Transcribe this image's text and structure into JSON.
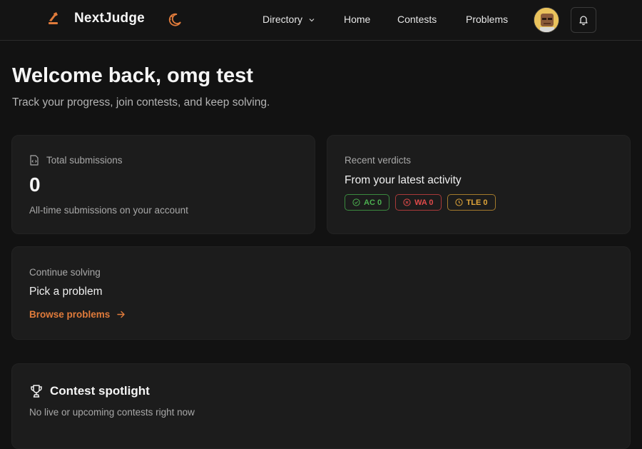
{
  "nav": {
    "brand_name": "NextJudge",
    "links": [
      {
        "label": "Directory"
      },
      {
        "label": "Home"
      },
      {
        "label": "Contests"
      },
      {
        "label": "Problems"
      }
    ],
    "icons": {
      "logo": "nextjudge-logo-icon",
      "theme": "moon-theme-icon",
      "bell": "bell-icon",
      "avatar": "avatar"
    }
  },
  "welcome": {
    "title": "Welcome back, omg test",
    "subtitle": "Track your progress, join contests, and keep solving."
  },
  "submissions": {
    "label": "Total submissions",
    "value": "0",
    "caption": "All-time submissions on your account"
  },
  "verdicts": {
    "label": "Recent verdicts",
    "title": "From your latest activity",
    "badges": [
      {
        "text": "AC 0",
        "color": "#4caf50"
      },
      {
        "text": "WA 0",
        "color": "#e04a4a"
      },
      {
        "text": "TLE 0",
        "color": "#e0a53a"
      }
    ]
  },
  "continue": {
    "label": "Continue solving",
    "title": "Pick a problem",
    "link": "Browse problems"
  },
  "spotlight": {
    "title": "Contest spotlight",
    "caption": "No live or upcoming contests right now"
  },
  "colors": {
    "accent": "#e07b3b",
    "background": "#121212",
    "card": "#1c1c1c"
  }
}
